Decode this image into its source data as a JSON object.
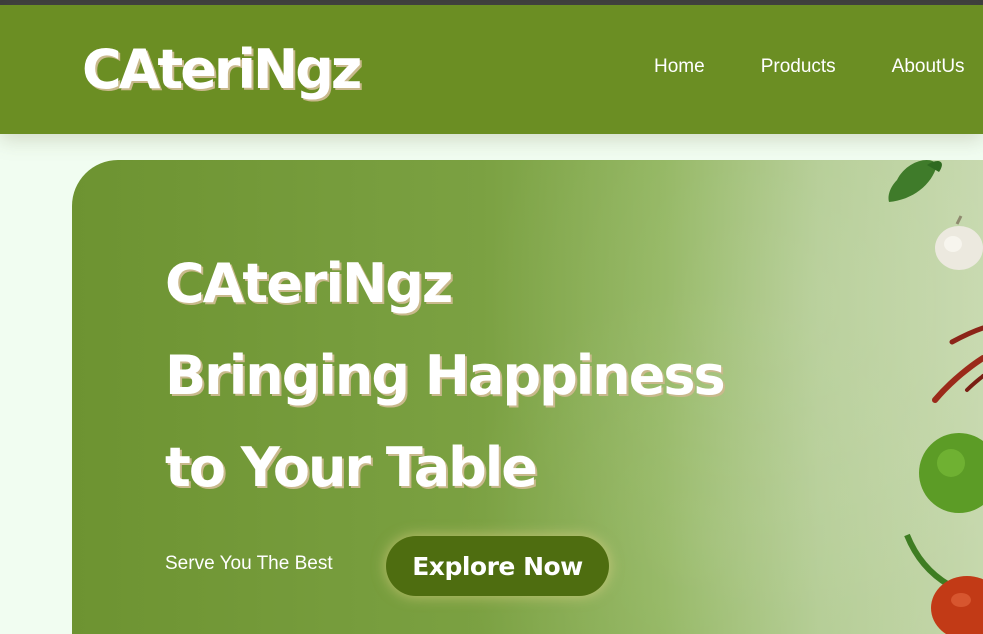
{
  "navbar": {
    "logo": "CAteriNgz",
    "links": [
      "Home",
      "Products",
      "AboutUs"
    ]
  },
  "hero": {
    "heading_lines": [
      "CAteriNgz",
      "Bringing Happiness",
      "to Your Table"
    ],
    "subtitle": "Serve You The Best",
    "cta_label": "Explore Now"
  },
  "colors": {
    "navbar": "#6b8e23",
    "button": "#4e6d10",
    "page_background": "#f1fdf1"
  },
  "icons": [
    "basil-leaf-icon",
    "garlic-icon",
    "chili-pepper-icon",
    "lime-icon",
    "tomato-icon"
  ]
}
